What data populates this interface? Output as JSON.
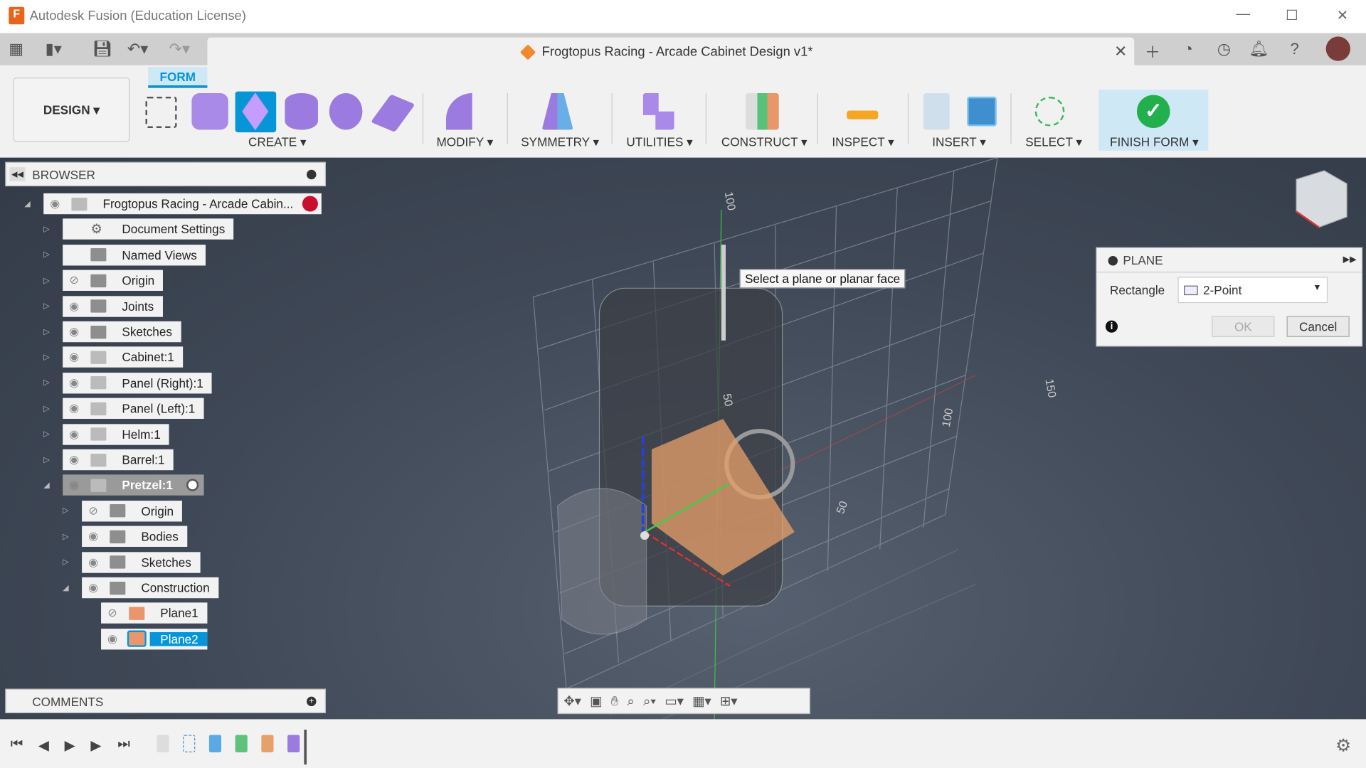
{
  "window": {
    "title": "Autodesk Fusion (Education License)",
    "logo_letter": "F"
  },
  "document": {
    "title": "Frogtopus Racing - Arcade Cabinet Design v1*"
  },
  "workspace": {
    "label": "DESIGN ▾",
    "active_tab": "FORM"
  },
  "toolbar": {
    "groups": [
      "CREATE ▾",
      "MODIFY ▾",
      "SYMMETRY ▾",
      "UTILITIES ▾",
      "CONSTRUCT ▾",
      "INSPECT ▾",
      "INSERT ▾",
      "SELECT ▾",
      "FINISH FORM ▾"
    ]
  },
  "browser": {
    "title": "BROWSER",
    "items": [
      {
        "label": "Frogtopus Racing - Arcade Cabin...",
        "level": 0,
        "expanded": true,
        "visible": true
      },
      {
        "label": "Document Settings",
        "level": 1,
        "icon": "gear"
      },
      {
        "label": "Named Views",
        "level": 1,
        "icon": "folder"
      },
      {
        "label": "Origin",
        "level": 1,
        "icon": "folder",
        "visible": false
      },
      {
        "label": "Joints",
        "level": 1,
        "icon": "folder",
        "visible": true
      },
      {
        "label": "Sketches",
        "level": 1,
        "icon": "folder",
        "visible": true
      },
      {
        "label": "Cabinet:1",
        "level": 1,
        "icon": "component",
        "visible": true
      },
      {
        "label": "Panel (Right):1",
        "level": 1,
        "icon": "component",
        "visible": true
      },
      {
        "label": "Panel (Left):1",
        "level": 1,
        "icon": "component",
        "visible": true
      },
      {
        "label": "Helm:1",
        "level": 1,
        "icon": "component",
        "visible": true
      },
      {
        "label": "Barrel:1",
        "level": 1,
        "icon": "component",
        "visible": true
      },
      {
        "label": "Pretzel:1",
        "level": 1,
        "icon": "component",
        "visible": true,
        "expanded": true,
        "active": true
      },
      {
        "label": "Origin",
        "level": 2,
        "icon": "folder",
        "visible": false
      },
      {
        "label": "Bodies",
        "level": 2,
        "icon": "folder",
        "visible": true
      },
      {
        "label": "Sketches",
        "level": 2,
        "icon": "folder",
        "visible": true
      },
      {
        "label": "Construction",
        "level": 2,
        "icon": "folder",
        "visible": true,
        "expanded": true
      },
      {
        "label": "Plane1",
        "level": 3,
        "icon": "plane",
        "visible": false
      },
      {
        "label": "Plane2",
        "level": 3,
        "icon": "plane",
        "visible": true,
        "selected": true
      }
    ]
  },
  "comments": {
    "title": "COMMENTS"
  },
  "viewport": {
    "tooltip": "Select a plane or planar face",
    "axis_labels": [
      "100",
      "50",
      "100",
      "50",
      "150"
    ]
  },
  "plane_dialog": {
    "title": "PLANE",
    "rectangle_label": "Rectangle",
    "rectangle_value": "2-Point",
    "ok": "OK",
    "cancel": "Cancel"
  },
  "colors": {
    "accent": "#0696d7",
    "form_purple": "#9b7be0",
    "finish_green": "#21b04b",
    "plane_orange": "#e8a06a"
  }
}
